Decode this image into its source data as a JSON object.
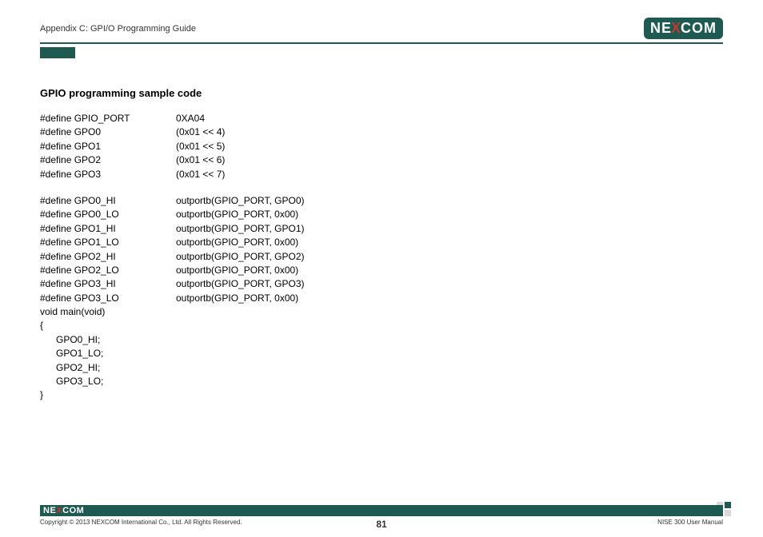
{
  "header": {
    "section": "Appendix C: GPI/O Programming Guide",
    "logo": {
      "left": "NE",
      "x": "X",
      "right": "COM"
    }
  },
  "content": {
    "title": "GPIO programming sample code",
    "defines_block1": [
      {
        "name": "#define GPIO_PORT",
        "val": "0XA04"
      },
      {
        "name": "#define GPO0",
        "val": "(0x01 << 4)"
      },
      {
        "name": "#define GPO1",
        "val": "(0x01 << 5)"
      },
      {
        "name": "#define GPO2",
        "val": "(0x01 << 6)"
      },
      {
        "name": "#define GPO3",
        "val": "(0x01 << 7)"
      }
    ],
    "defines_block2": [
      {
        "name": "#define GPO0_HI",
        "val": "outportb(GPIO_PORT, GPO0)"
      },
      {
        "name": "#define GPO0_LO",
        "val": "outportb(GPIO_PORT, 0x00)"
      },
      {
        "name": "#define GPO1_HI",
        "val": "outportb(GPIO_PORT, GPO1)"
      },
      {
        "name": "#define GPO1_LO",
        "val": "outportb(GPIO_PORT, 0x00)"
      },
      {
        "name": "#define GPO2_HI",
        "val": "outportb(GPIO_PORT, GPO2)"
      },
      {
        "name": "#define GPO2_LO",
        "val": "outportb(GPIO_PORT, 0x00)"
      },
      {
        "name": "#define GPO3_HI",
        "val": "outportb(GPIO_PORT, GPO3)"
      },
      {
        "name": "#define GPO3_LO",
        "val": "outportb(GPIO_PORT, 0x00)"
      }
    ],
    "main_sig": "void main(void)",
    "brace_open": "{",
    "main_body": [
      "GPO0_HI;",
      "GPO1_LO;",
      "GPO2_HI;",
      "GPO3_LO;"
    ],
    "brace_close": "}"
  },
  "footer": {
    "logo": {
      "left": "NE",
      "x": "X",
      "right": "COM"
    },
    "copyright": "Copyright © 2013 NEXCOM International Co., Ltd. All Rights Reserved.",
    "page": "81",
    "manual": "NISE 300 User Manual"
  }
}
